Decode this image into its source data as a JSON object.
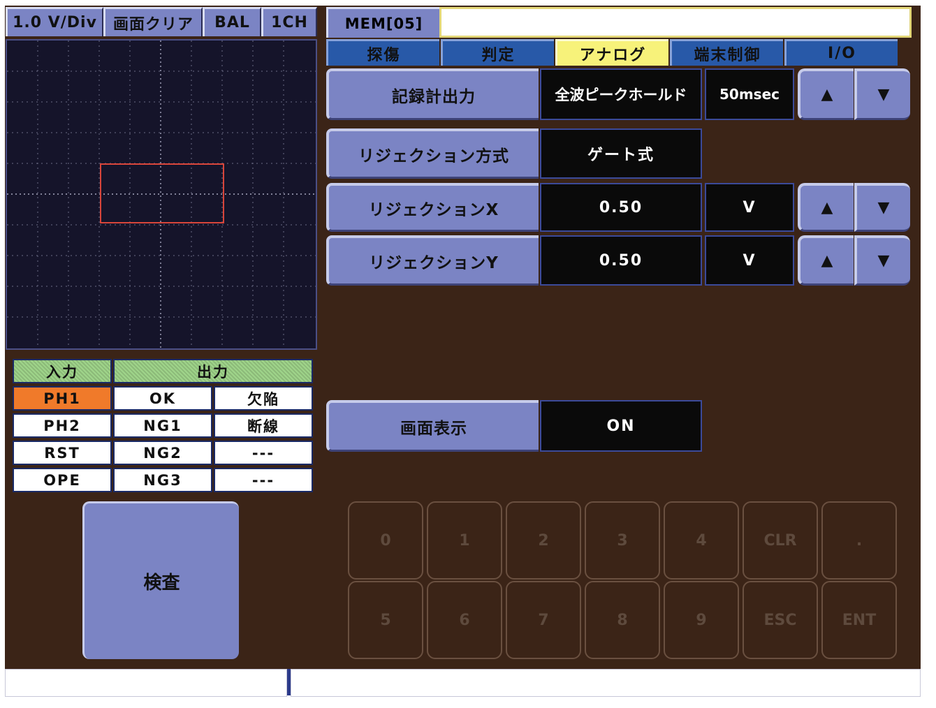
{
  "toolbar": {
    "volt_div": "1.0 V/Div",
    "clear_screen": "画面クリア",
    "bal": "BAL",
    "channel": "1CH"
  },
  "memory": {
    "label": "MEM[05]",
    "field_value": ""
  },
  "tabs": [
    {
      "label": "探傷",
      "active": false
    },
    {
      "label": "判定",
      "active": false
    },
    {
      "label": "アナログ",
      "active": true
    },
    {
      "label": "端末制御",
      "active": false
    },
    {
      "label": "I/O",
      "active": false
    }
  ],
  "settings": {
    "recorder_output": {
      "label": "記録計出力",
      "mode": "全波ピークホールド",
      "time": "50msec"
    },
    "rejection_method": {
      "label": "リジェクション方式",
      "value": "ゲート式"
    },
    "rejection_x": {
      "label": "リジェクションX",
      "value": "0.50",
      "unit": "V"
    },
    "rejection_y": {
      "label": "リジェクションY",
      "value": "0.50",
      "unit": "V"
    },
    "screen_display": {
      "label": "画面表示",
      "value": "ON"
    }
  },
  "arrows": {
    "up": "▲",
    "down": "▼"
  },
  "io_table": {
    "input_header": "入力",
    "output_header": "出力",
    "rows": [
      {
        "input": "PH1",
        "out1": "OK",
        "out2": "欠陥",
        "input_active": true
      },
      {
        "input": "PH2",
        "out1": "NG1",
        "out2": "断線",
        "input_active": false
      },
      {
        "input": "RST",
        "out1": "NG2",
        "out2": "---",
        "input_active": false
      },
      {
        "input": "OPE",
        "out1": "NG3",
        "out2": "---",
        "input_active": false
      }
    ]
  },
  "inspect_button": "検査",
  "keypad": {
    "row1": [
      "0",
      "1",
      "2",
      "3",
      "4",
      "CLR",
      "."
    ],
    "row2": [
      "5",
      "6",
      "7",
      "8",
      "9",
      "ESC",
      "ENT"
    ]
  },
  "colors": {
    "background": "#3b2417",
    "button": "#7b84c4",
    "active_tab": "#f7f27a",
    "active_input": "#f07a2a",
    "gate_box": "#d9453a"
  }
}
